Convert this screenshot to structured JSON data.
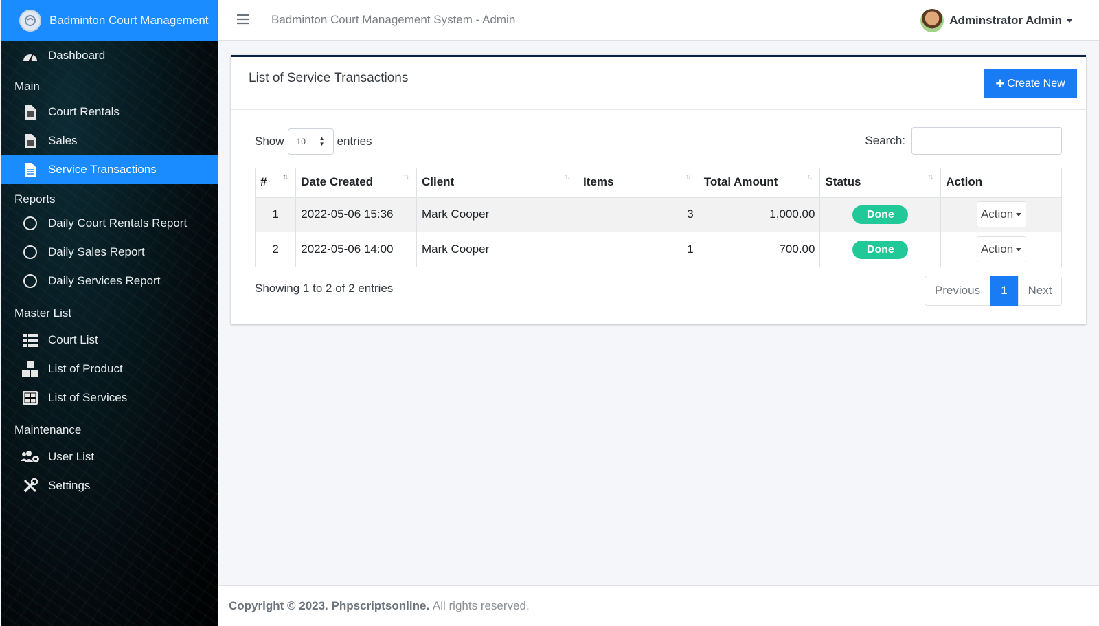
{
  "sidebar": {
    "brand": "Badminton Court Management",
    "dashboard": "Dashboard",
    "section_main": "Main",
    "court_rentals": "Court Rentals",
    "sales": "Sales",
    "service_transactions": "Service Transactions",
    "section_reports": "Reports",
    "daily_court_rentals_report": "Daily Court Rentals Report",
    "daily_sales_report": "Daily Sales Report",
    "daily_services_report": "Daily Services Report",
    "section_master": "Master List",
    "court_list": "Court List",
    "list_of_product": "List of Product",
    "list_of_services": "List of Services",
    "section_maintenance": "Maintenance",
    "user_list": "User List",
    "settings": "Settings"
  },
  "topbar": {
    "title": "Badminton Court Management System - Admin",
    "user_name": "Adminstrator Admin"
  },
  "card": {
    "title": "List of Service Transactions",
    "create_label": "Create New",
    "show_label": "Show",
    "entries_value": "10",
    "entries_label": "entries",
    "search_label": "Search:",
    "search_value": ""
  },
  "table": {
    "columns": [
      "#",
      "Date Created",
      "Client",
      "Items",
      "Total Amount",
      "Status",
      "Action"
    ],
    "rows": [
      {
        "no": "1",
        "date": "2022-05-06 15:36",
        "client": "Mark Cooper",
        "items": "3",
        "total": "1,000.00",
        "status": "Done",
        "action": "Action"
      },
      {
        "no": "2",
        "date": "2022-05-06 14:00",
        "client": "Mark Cooper",
        "items": "1",
        "total": "700.00",
        "status": "Done",
        "action": "Action"
      }
    ]
  },
  "pagination": {
    "info": "Showing 1 to 2 of 2 entries",
    "previous": "Previous",
    "current": "1",
    "next": "Next"
  },
  "footer": {
    "copyright": "Copyright © 2023.",
    "company": "Phpscriptsonline.",
    "rights": "All rights reserved."
  },
  "colors": {
    "accent": "#1a8cff",
    "primary_button": "#1a7cf5",
    "status_done": "#20c997",
    "card_top_border": "#0b2447"
  }
}
